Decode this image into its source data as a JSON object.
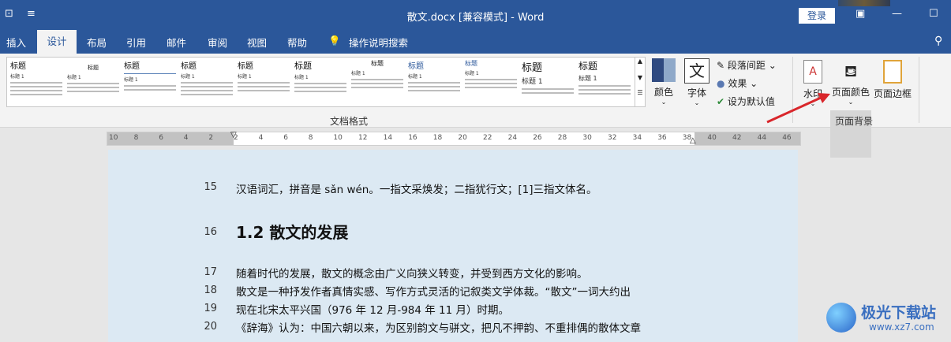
{
  "window": {
    "title": "散文.docx [兼容模式]  -  Word",
    "login": "登录",
    "qa_icons": [
      "touch-mode-icon",
      "customize-icon"
    ]
  },
  "tabs": [
    "插入",
    "设计",
    "布局",
    "引用",
    "邮件",
    "审阅",
    "视图",
    "帮助",
    "操作说明搜索"
  ],
  "active_tab": "设计",
  "gallery": {
    "thumb_title": "标题",
    "thumb_sub": "标题 1",
    "group_label": "文档格式"
  },
  "design": {
    "colors": "颜色",
    "fonts": "字体",
    "font_glyph": "文",
    "paragraph_spacing": "段落间距",
    "effects": "效果",
    "set_default": "设为默认值"
  },
  "page_background": {
    "watermark": "水印",
    "page_color": "页面颜色",
    "page_border": "页面边框",
    "group_label": "页面背景"
  },
  "ruler": [
    "10",
    "8",
    "6",
    "4",
    "2",
    "2",
    "4",
    "6",
    "8",
    "10",
    "12",
    "14",
    "16",
    "18",
    "20",
    "22",
    "24",
    "26",
    "28",
    "30",
    "32",
    "34",
    "36",
    "38",
    "40",
    "42",
    "44",
    "46"
  ],
  "document": {
    "lines": [
      {
        "num": "15",
        "text": "汉语词汇，拼音是 sǎn wén。一指文采焕发；二指犹行文；[1]三指文体名。"
      },
      {
        "num": "16",
        "text": "1.2 散文的发展"
      },
      {
        "num": "17",
        "text": "随着时代的发展，散文的概念由广义向狭义转变，并受到西方文化的影响。"
      },
      {
        "num": "18",
        "text": "散文是一种抒发作者真情实感、写作方式灵活的记叙类文学体裁。“散文”一词大约出"
      },
      {
        "num": "19",
        "text": "现在北宋太平兴国（976 年 12 月-984 年 11 月）时期。"
      },
      {
        "num": "20",
        "text": "《辞海》认为：中国六朝以来，为区别韵文与骈文，把凡不押韵、不重排偶的散体文章"
      }
    ]
  },
  "overlay": {
    "site_name": "极光下载站",
    "site_url": "www.xz7.com"
  },
  "colors": {
    "title_bar": "#2b579a",
    "arrow": "#d9262b"
  }
}
